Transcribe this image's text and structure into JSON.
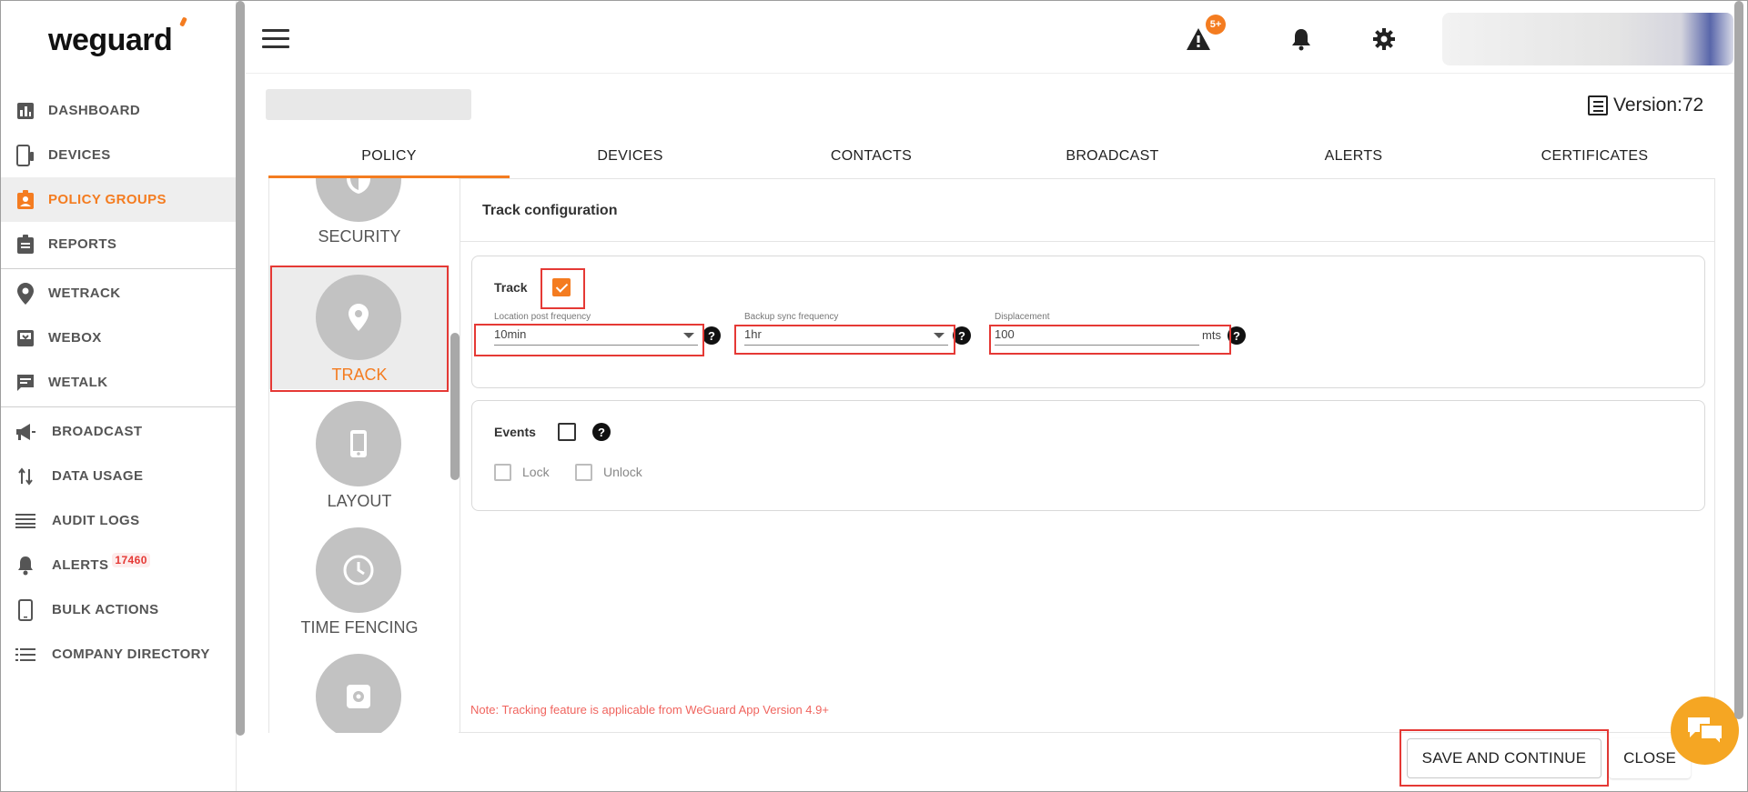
{
  "brand": {
    "logo_text": "weguard",
    "accent": "#f47c20"
  },
  "sidebar": {
    "items": [
      {
        "label": "DASHBOARD",
        "icon": "bar-chart-icon"
      },
      {
        "label": "DEVICES",
        "icon": "phone-tablet-icon"
      },
      {
        "label": "POLICY GROUPS",
        "icon": "policy-badge-icon",
        "active": true
      },
      {
        "label": "REPORTS",
        "icon": "clipboard-icon"
      },
      {
        "label": "WETRACK",
        "icon": "location-pin-icon"
      },
      {
        "label": "WEBOX",
        "icon": "inbox-icon"
      },
      {
        "label": "WETALK",
        "icon": "chat-icon"
      },
      {
        "label": "BROADCAST",
        "icon": "megaphone-icon"
      },
      {
        "label": "DATA USAGE",
        "icon": "transfer-arrows-icon"
      },
      {
        "label": "AUDIT LOGS",
        "icon": "lines-icon"
      },
      {
        "label": "ALERTS",
        "icon": "alert-bell-icon",
        "badge": "17460"
      },
      {
        "label": "BULK ACTIONS",
        "icon": "phone-icon"
      },
      {
        "label": "COMPANY DIRECTORY",
        "icon": "list-icon"
      }
    ]
  },
  "header": {
    "alerts_badge": "5+"
  },
  "page": {
    "version_label": "Version:72"
  },
  "tabs": [
    "POLICY",
    "DEVICES",
    "CONTACTS",
    "BROADCAST",
    "ALERTS",
    "CERTIFICATES"
  ],
  "policy_nav": {
    "items": [
      {
        "label": "SECURITY",
        "icon": "shield-icon"
      },
      {
        "label": "TRACK",
        "icon": "location-pin-icon",
        "selected": true
      },
      {
        "label": "LAYOUT",
        "icon": "phone-icon"
      },
      {
        "label": "TIME FENCING",
        "icon": "clock-icon"
      },
      {
        "label": "",
        "icon": "settings-app-icon"
      }
    ]
  },
  "track_config": {
    "title": "Track configuration",
    "track": {
      "label": "Track",
      "checked": true
    },
    "location_post_frequency": {
      "label": "Location post frequency",
      "value": "10min"
    },
    "backup_sync_frequency": {
      "label": "Backup sync frequency",
      "value": "1hr"
    },
    "displacement": {
      "label": "Displacement",
      "value": "100",
      "unit": "mts"
    },
    "help_glyph": "?",
    "events": {
      "label": "Events",
      "checked": false
    },
    "lock": {
      "label": "Lock"
    },
    "unlock": {
      "label": "Unlock"
    },
    "note": "Note: Tracking feature is applicable from WeGuard App Version 4.9+"
  },
  "actions": {
    "save_label": "SAVE AND CONTINUE",
    "close_label": "CLOSE"
  }
}
